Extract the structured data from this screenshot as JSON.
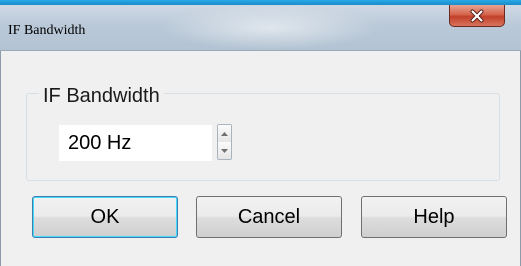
{
  "window": {
    "title": "IF Bandwidth",
    "close_label": "x"
  },
  "group": {
    "legend": "IF Bandwidth",
    "field": {
      "value": "200 Hz"
    }
  },
  "buttons": {
    "ok_label": "OK",
    "cancel_label": "Cancel",
    "help_label": "Help"
  },
  "colors": {
    "accent": "#1a8cc8",
    "close_button": "#c2402a",
    "client_background": "#f0f0f0",
    "default_button_border": "#3c7fb1"
  },
  "icons": {
    "close": "close-icon",
    "spin_up": "arrow-up-icon",
    "spin_down": "arrow-down-icon"
  }
}
